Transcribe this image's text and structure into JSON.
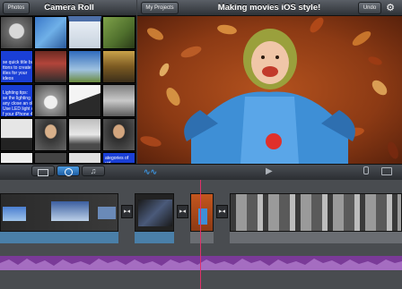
{
  "top_bar": {
    "photos_label": "Photos",
    "camera_roll_title": "Camera Roll",
    "my_projects_label": "My Projects",
    "project_title": "Making movies iOS style!",
    "undo_label": "Undo",
    "settings_icon": "gear-icon"
  },
  "media": {
    "thumb_texts": [
      "se quick title bu\nttons to create\nitles for your\nideos",
      "Lighting tips:\nse the lighting\nany close an ob\nUse LED light c\nf your iPhone 4",
      "ategories of vid"
    ]
  },
  "toolbar": {
    "icons": [
      "video-filter-icon",
      "photo-filter-icon",
      "music-filter-icon",
      "audio-waveform-icon",
      "play-icon",
      "microphone-icon",
      "camera-icon"
    ],
    "accent": "#3c8fd6"
  },
  "timeline": {
    "transition_glyph": "▸◂",
    "audio_color": "#8a3fa8",
    "playhead_color": "#e0306a"
  }
}
